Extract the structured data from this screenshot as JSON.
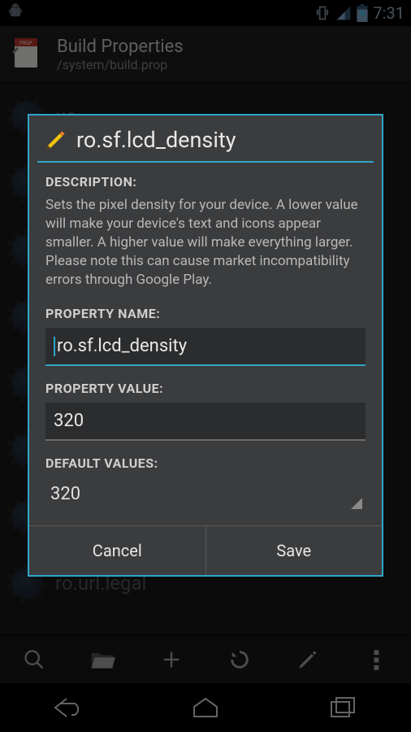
{
  "status_bar": {
    "time": "7:31"
  },
  "action_bar": {
    "title": "Build Properties",
    "subtitle": "/system/build.prop"
  },
  "background_items": [
    "us",
    "",
    "",
    "",
    "",
    "",
    "",
    "ro.url.legal"
  ],
  "dialog": {
    "title": "ro.sf.lcd_density",
    "description_label": "DESCRIPTION:",
    "description_text": "Sets the pixel density for your device. A lower value will make your device's text and icons appear smaller. A higher value will make everything larger. Please note this can cause market incompatibility errors through Google Play.",
    "property_name_label": "PROPERTY NAME:",
    "property_name_value": "ro.sf.lcd_density",
    "property_value_label": "PROPERTY VALUE:",
    "property_value_value": "320",
    "default_values_label": "DEFAULT VALUES:",
    "default_value_selected": "320",
    "cancel_label": "Cancel",
    "save_label": "Save"
  },
  "colors": {
    "accent": "#2fa6c9",
    "dialog_bg": "#3b3c3e"
  }
}
